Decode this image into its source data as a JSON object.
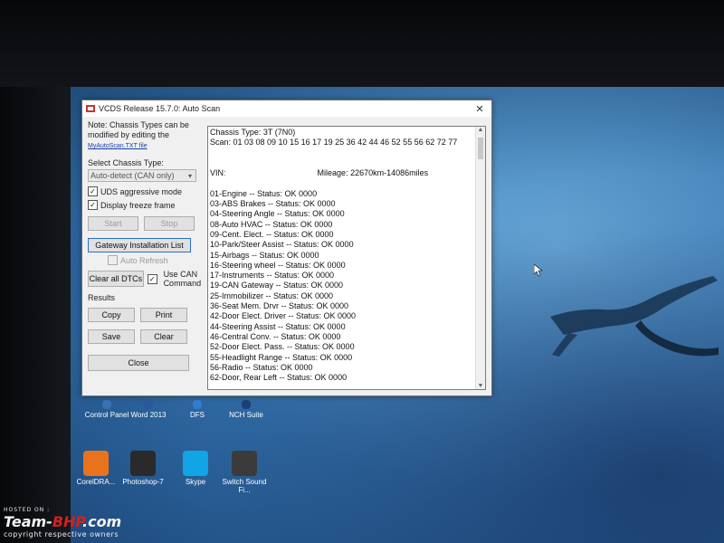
{
  "window": {
    "title": "VCDS Release 15.7.0:  Auto Scan",
    "close_glyph": "✕"
  },
  "left_panel": {
    "note": "Note:  Chassis Types can be modified by editing the",
    "note_link": "MyAutoScan.TXT file",
    "select_label": "Select Chassis Type:",
    "select_value": "Auto-detect (CAN only)",
    "uds_label": "UDS aggressive mode",
    "freeze_label": "Display freeze frame",
    "start_label": "Start",
    "stop_label": "Stop",
    "gateway_label": "Gateway Installation List",
    "auto_refresh_label": "Auto Refresh",
    "clear_dtcs_label": "Clear all DTCs",
    "use_can_label": "Use CAN Command",
    "results_label": "Results",
    "copy_label": "Copy",
    "print_label": "Print",
    "save_label": "Save",
    "clear_label": "Clear",
    "close_label": "Close"
  },
  "log": {
    "chassis": "Chassis Type: 3T (7N0)",
    "scan": "Scan: 01 03 08 09 10 15 16 17 19 25 36 42 44 46 52 55 56 62 72 77",
    "vin_prefix": "VIN:",
    "vin_suffix": "Mileage: 22670km-14086miles",
    "modules": [
      "01-Engine -- Status: OK 0000",
      "03-ABS Brakes -- Status: OK 0000",
      "04-Steering Angle -- Status: OK 0000",
      "08-Auto HVAC -- Status: OK 0000",
      "09-Cent. Elect. -- Status: OK 0000",
      "10-Park/Steer Assist -- Status: OK 0000",
      "15-Airbags -- Status: OK 0000",
      "16-Steering wheel -- Status: OK 0000",
      "17-Instruments -- Status: OK 0000",
      "19-CAN Gateway -- Status: OK 0000",
      "25-Immobilizer -- Status: OK 0000",
      "36-Seat Mem. Drvr -- Status: OK 0000",
      "42-Door Elect. Driver -- Status: OK 0000",
      "44-Steering Assist -- Status: OK 0000",
      "46-Central Conv. -- Status: OK 0000",
      "52-Door Elect. Pass. -- Status: OK 0000",
      "55-Headlight Range -- Status: OK 0000",
      "56-Radio -- Status: OK 0000",
      "62-Door, Rear Left -- Status: OK 0000"
    ]
  },
  "desktop_icons": [
    {
      "label": "Control Panel",
      "color": "#3a6fb5"
    },
    {
      "label": "Word 2013",
      "color": "#2b579a"
    },
    {
      "label": "DFS",
      "color": "#2d7dd2"
    },
    {
      "label": "NCH Suite",
      "color": "#1d3f7a"
    },
    {
      "label": "CorelDRA...",
      "color": "#e8731c"
    },
    {
      "label": "Photoshop-7",
      "color": "#2a2a2a"
    },
    {
      "label": "Skype",
      "color": "#12a5e6"
    },
    {
      "label": "Switch Sound Fi...",
      "color": "#3b3b3b"
    }
  ],
  "watermark": {
    "hosted": "HOSTED ON :",
    "brand_a": "Team-",
    "brand_b": "BHP",
    "brand_c": ".com",
    "copy": "copyright respective owners"
  }
}
